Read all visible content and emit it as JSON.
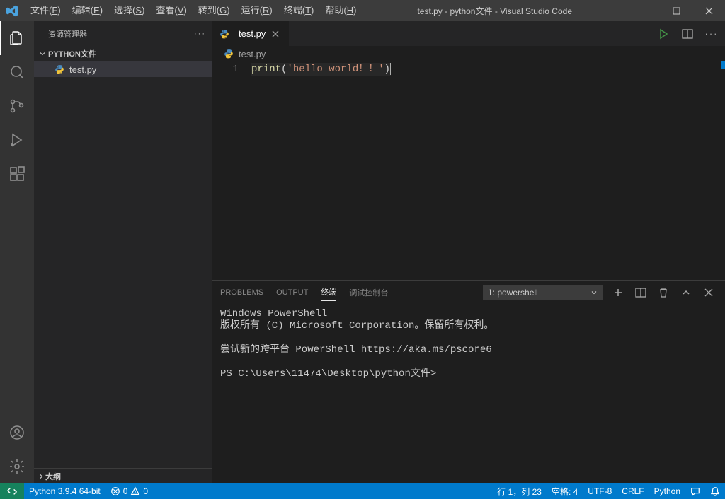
{
  "titlebar": {
    "menu": [
      {
        "label": "文件",
        "mnemonic": "F"
      },
      {
        "label": "编辑",
        "mnemonic": "E"
      },
      {
        "label": "选择",
        "mnemonic": "S"
      },
      {
        "label": "查看",
        "mnemonic": "V"
      },
      {
        "label": "转到",
        "mnemonic": "G"
      },
      {
        "label": "运行",
        "mnemonic": "R"
      },
      {
        "label": "终端",
        "mnemonic": "T"
      },
      {
        "label": "帮助",
        "mnemonic": "H"
      }
    ],
    "title": "test.py - python文件 - Visual Studio Code"
  },
  "sidebar": {
    "title": "资源管理器",
    "project": "PYTHON文件",
    "files": [
      {
        "name": "test.py"
      }
    ],
    "outline": "大纲"
  },
  "editor": {
    "tab_label": "test.py",
    "breadcrumb": "test.py",
    "line_number": "1",
    "code_fn": "print",
    "code_open": "(",
    "code_str": "'hello world！！'",
    "code_close": ")"
  },
  "panel": {
    "tabs": {
      "problems": "PROBLEMS",
      "output": "OUTPUT",
      "terminal": "终端",
      "debug": "调试控制台"
    },
    "terminal_select": "1: powershell",
    "terminal_lines": "Windows PowerShell\n版权所有 (C) Microsoft Corporation。保留所有权利。\n\n尝试新的跨平台 PowerShell https://aka.ms/pscore6\n\nPS C:\\Users\\11474\\Desktop\\python文件>"
  },
  "statusbar": {
    "python": "Python 3.9.4 64-bit",
    "errors": "0",
    "warnings": "0",
    "line_col": "行 1，列 23",
    "spaces": "空格: 4",
    "encoding": "UTF-8",
    "eol": "CRLF",
    "lang": "Python"
  }
}
